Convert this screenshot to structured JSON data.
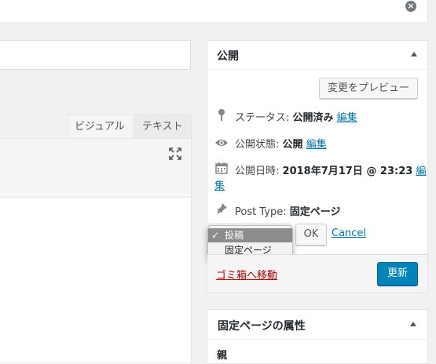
{
  "notice": {
    "close_glyph": "×"
  },
  "editor": {
    "tabs": [
      {
        "label": "ビジュアル",
        "active": true
      },
      {
        "label": "テキスト",
        "active": false
      }
    ],
    "fullscreen_icon": "fullscreen-icon"
  },
  "publish": {
    "title": "公開",
    "preview_label": "変更をプレビュー",
    "status": {
      "label": "ステータス:",
      "value": "公開済み",
      "edit": "編集",
      "icon": "pin-icon"
    },
    "visibility": {
      "label": "公開状態:",
      "value": "公開",
      "edit": "編集",
      "icon": "eye-icon"
    },
    "date": {
      "label": "公開日時:",
      "value": "2018年7月17日 @ 23:23",
      "edit_first": "編",
      "edit_second": "集",
      "icon": "calendar-icon"
    },
    "post_type": {
      "label": "Post Type:",
      "value": "固定ページ",
      "icon": "thumbtack-icon"
    },
    "select_options": [
      {
        "label": "投稿",
        "checked": true
      },
      {
        "label": "固定ページ",
        "checked": false
      }
    ],
    "ok_label": "OK",
    "cancel_label": "Cancel",
    "trash_label": "ゴミ箱へ移動",
    "update_label": "更新"
  },
  "attributes": {
    "title": "固定ページの属性",
    "first_label": "親"
  },
  "colors": {
    "primary_button": "#0085ba",
    "link": "#0073aa",
    "trash": "#aa0000",
    "selected_option": "#8c8c8c"
  }
}
